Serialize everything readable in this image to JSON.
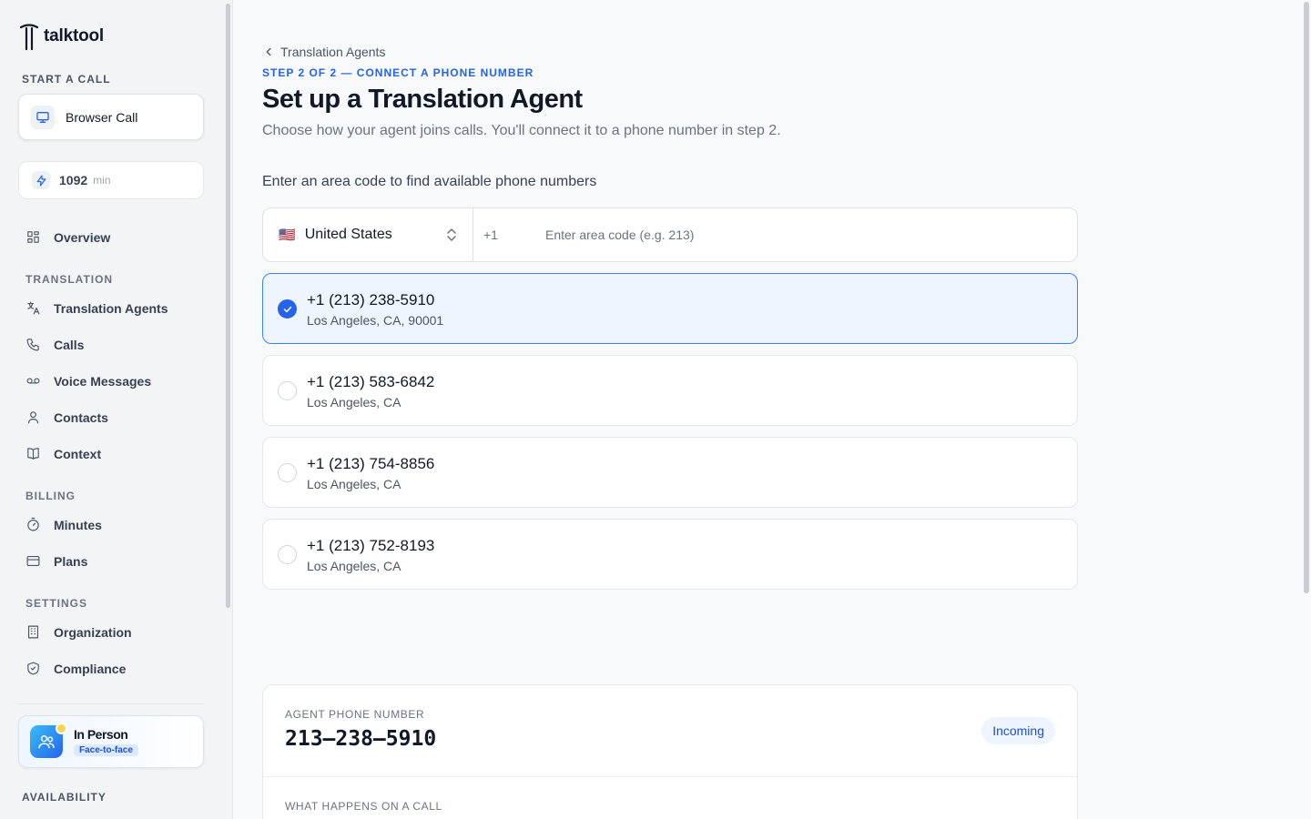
{
  "app": {
    "name": "talktool"
  },
  "sidebar": {
    "start_label": "START A CALL",
    "browser_call": "Browser Call",
    "minutes": {
      "value": "1092",
      "unit": "min"
    },
    "overview": "Overview",
    "translation_label": "TRANSLATION",
    "translation_items": [
      "Translation Agents",
      "Calls",
      "Voice Messages",
      "Contacts",
      "Context"
    ],
    "billing_label": "BILLING",
    "billing_items": [
      "Minutes",
      "Plans"
    ],
    "settings_label": "SETTINGS",
    "settings_items": [
      "Organization",
      "Compliance"
    ],
    "in_person": {
      "title": "In Person",
      "badge": "Face-to-face"
    },
    "availability_label": "AVAILABILITY"
  },
  "main": {
    "breadcrumb": "Translation Agents",
    "step": "STEP 2 OF 2 — CONNECT A PHONE NUMBER",
    "title": "Set up a Translation Agent",
    "subtitle": "Choose how your agent joins calls. You'll connect it to a phone number in step 2.",
    "prompt": "Enter an area code to find available phone numbers",
    "country": {
      "flag": "🇺🇸",
      "name": "United States",
      "dial": "+1"
    },
    "area_input": {
      "value": "",
      "placeholder": "Enter area code (e.g. 213)"
    },
    "options": [
      {
        "number": "+1 (213) 238-5910",
        "location": "Los Angeles, CA, 90001",
        "selected": true
      },
      {
        "number": "+1 (213) 583-6842",
        "location": "Los Angeles, CA",
        "selected": false
      },
      {
        "number": "+1 (213) 754-8856",
        "location": "Los Angeles, CA",
        "selected": false
      },
      {
        "number": "+1 (213) 752-8193",
        "location": "Los Angeles, CA",
        "selected": false
      }
    ],
    "summary": {
      "label": "AGENT PHONE NUMBER",
      "number": "213–238–5910",
      "badge": "Incoming",
      "label2": "WHAT HAPPENS ON A CALL"
    }
  },
  "colors": {
    "accent": "#2563eb",
    "selected_bg": "#eef5ff"
  }
}
